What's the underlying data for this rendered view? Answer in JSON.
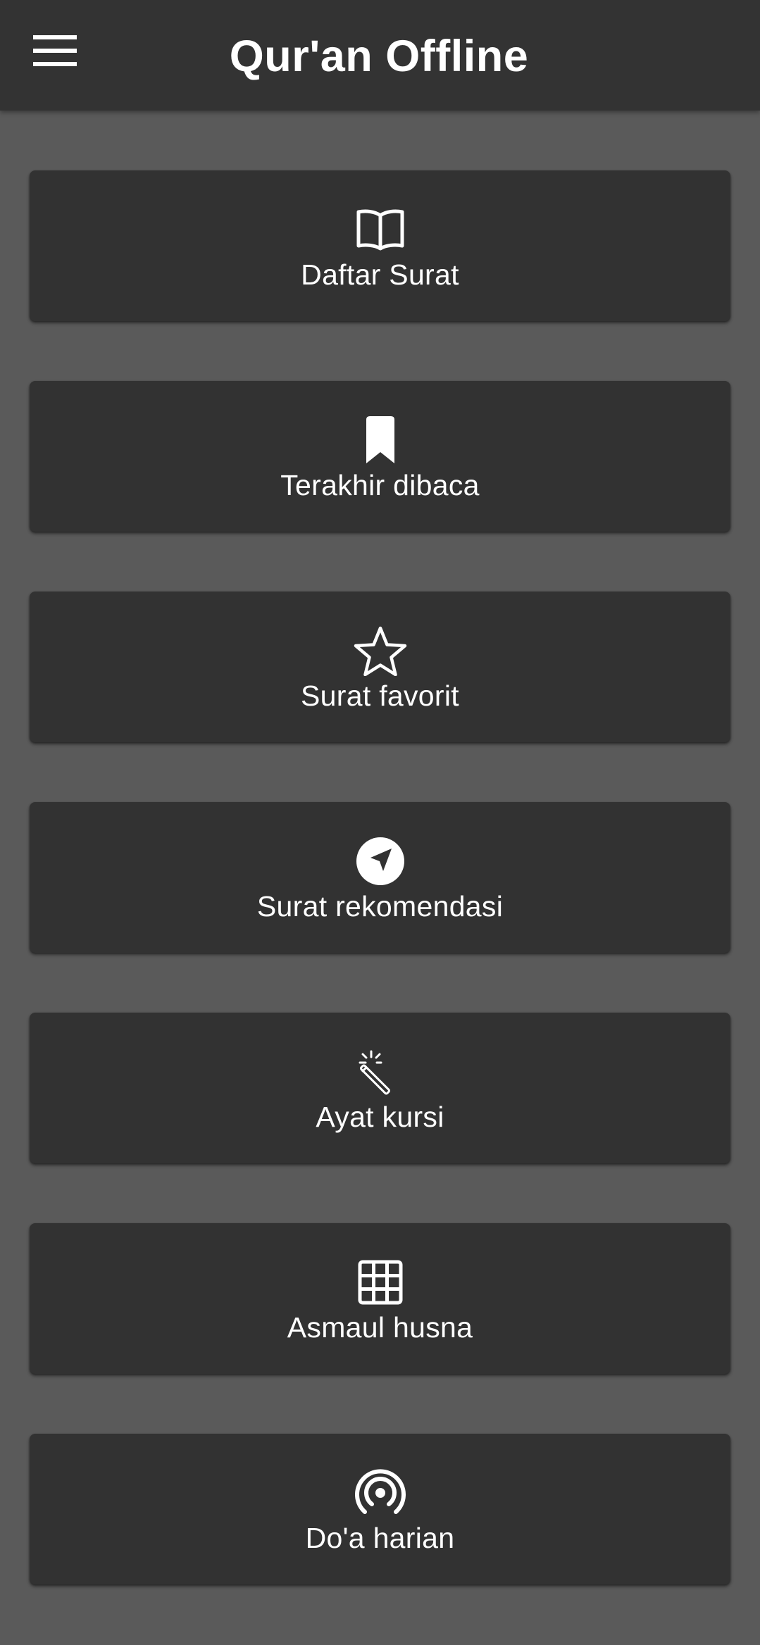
{
  "app_bar": {
    "title": "Qur'an Offline",
    "menu_icon": "hamburger-menu-icon"
  },
  "menu": {
    "items": [
      {
        "label": "Daftar Surat",
        "icon": "open-book-icon"
      },
      {
        "label": "Terakhir dibaca",
        "icon": "bookmark-icon"
      },
      {
        "label": "Surat favorit",
        "icon": "star-outline-icon"
      },
      {
        "label": "Surat rekomendasi",
        "icon": "navigation-arrow-icon"
      },
      {
        "label": "Ayat kursi",
        "icon": "magic-wand-icon"
      },
      {
        "label": "Asmaul husna",
        "icon": "grid-icon"
      },
      {
        "label": "Do'a harian",
        "icon": "broadcast-icon"
      }
    ]
  },
  "colors": {
    "app_bar": "#333333",
    "background": "#5a5a5a",
    "card": "#323232",
    "text": "#ffffff"
  }
}
